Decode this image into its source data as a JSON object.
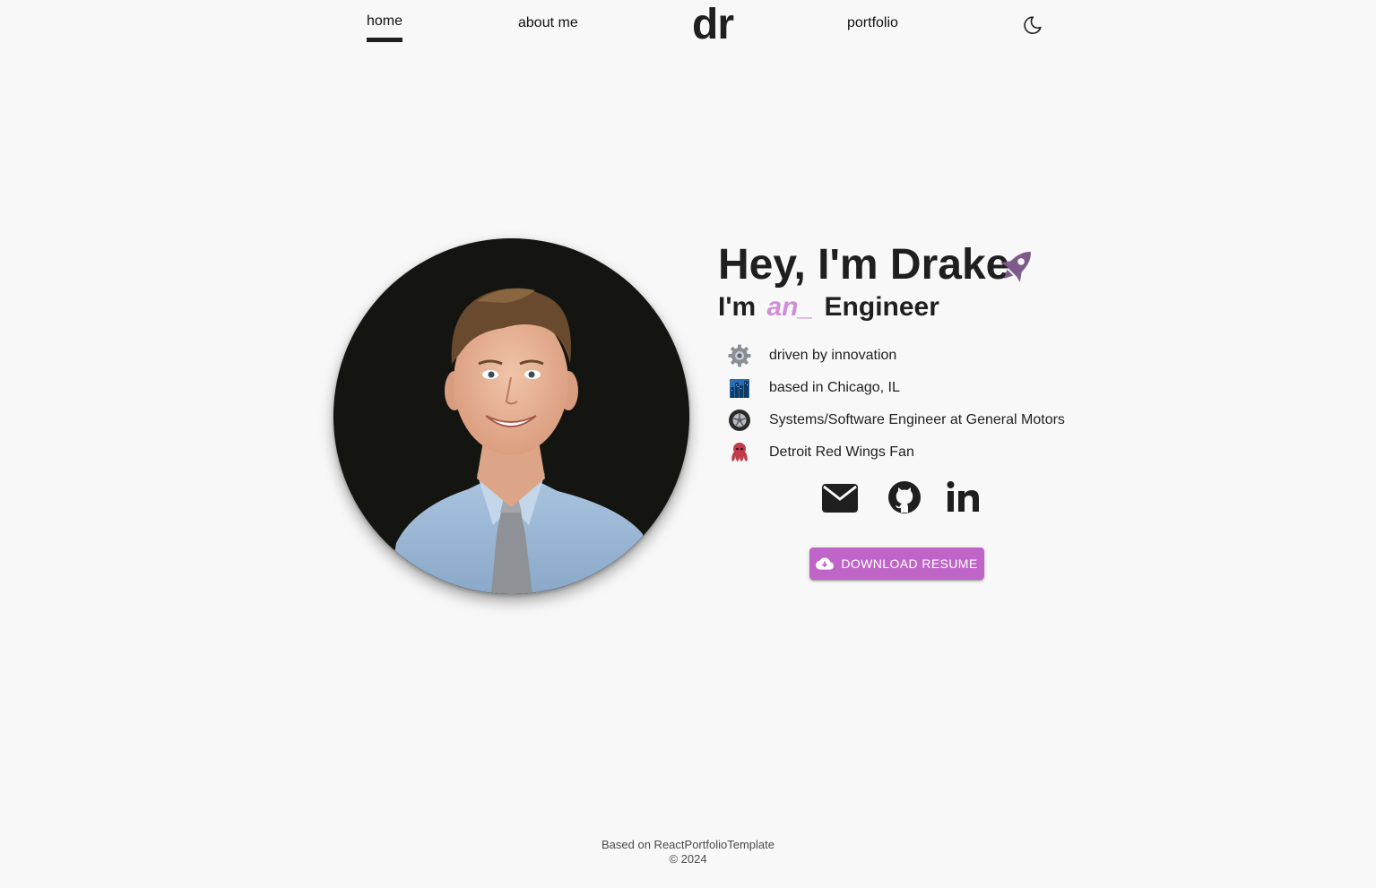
{
  "nav": {
    "home_label": "home",
    "about_label": "about me",
    "logo_text": "dr",
    "portfolio_label": "portfolio"
  },
  "hero": {
    "title": "Hey, I'm Drake",
    "subtitle_prefix": "I'm",
    "subtitle_typed": "an_",
    "subtitle_suffix": "Engineer",
    "facts": [
      {
        "emoji": "gear",
        "text": "driven by innovation"
      },
      {
        "emoji": "cityscape",
        "text": "based in Chicago, IL"
      },
      {
        "emoji": "wheel",
        "text": "Systems/Software Engineer at General Motors"
      },
      {
        "emoji": "octopus",
        "text": "Detroit Red Wings Fan"
      }
    ],
    "socials": [
      "email-icon",
      "github-icon",
      "linkedin-icon"
    ],
    "resume_label": "DOWNLOAD RESUME"
  },
  "footer": {
    "line1": "Based on ReactPortfolioTemplate",
    "line2": "© 2024"
  },
  "colors": {
    "accent": "#c065c8",
    "typed": "#d08ed8",
    "rocket": "#7e5a8a",
    "background": "#f8f8f8",
    "text": "#1f1f1f"
  }
}
